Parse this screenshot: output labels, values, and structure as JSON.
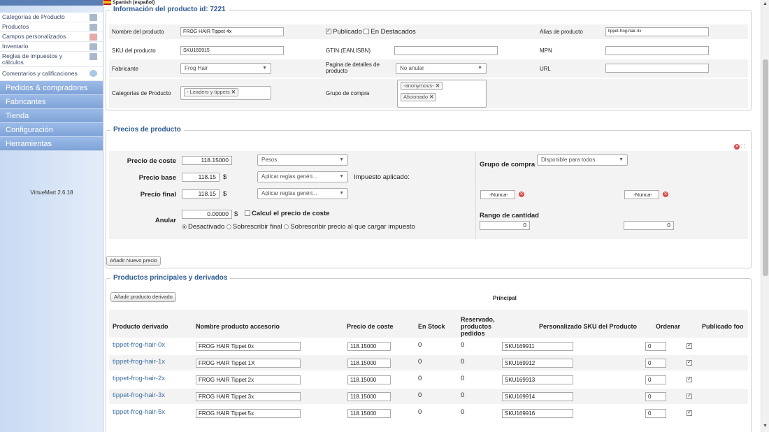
{
  "sidebar": {
    "items": [
      "Categorías de Producto",
      "Productos",
      "Campos personalizados",
      "Inventario",
      "Reglas de impuestos y cálculos",
      "Comentarios y calificaciones"
    ],
    "menu": [
      "Pedidos & compradores",
      "Fabricantes",
      "Tienda",
      "Configuración",
      "Herramientas"
    ],
    "version": "VirtueMart 2.6.18"
  },
  "lang": "Spanish (español)",
  "info": {
    "legend": "Información del producto id: 7221",
    "name_label": "Nombre del producto",
    "name_value": "FROG HAIR Tippet 4x",
    "published": "Publicado",
    "featured": "En Destacados",
    "alias_label": "Alias de producto",
    "alias_value": "tippet-frog-hair-4x",
    "sku_label": "SKU del producto",
    "sku_value": "SKU169915",
    "gtin_label": "GTIN (EAN,ISBN)",
    "mpn_label": "MPN",
    "mfr_label": "Fabricante",
    "mfr_value": "Frog Hair",
    "detail_label": "Pagina de detalles de producto",
    "detail_value": "No anular",
    "url_label": "URL",
    "cat_label": "Categorías de Producto",
    "cat_chip": "- Leaders y tippets",
    "group_label": "Grupo de compra",
    "group_chips": [
      "-anonymous-",
      "Aficionado"
    ]
  },
  "price": {
    "legend": "Precios de producto",
    "cost_label": "Precio de coste",
    "cost_value": "118.15000",
    "currency": "Pesos",
    "group_label": "Grupo de compra",
    "group_value": "Disponible para todos",
    "base_label": "Precio base",
    "base_value": "118.15",
    "dollar": "$",
    "rule": "Aplicar reglas genéri...",
    "tax_label": "Impuesto aplicado:",
    "final_label": "Precio final",
    "final_value": "118.15",
    "never1": "-Nunca-",
    "never2": "-Nunca-",
    "override_label": "Anular",
    "override_value": "0.00000",
    "calc_label": "Calcul el precio de coste",
    "opt1": "Desactivado",
    "opt2": "Sobrescribir final",
    "opt3": "Sobrescribir precio al que cargar impuesto",
    "range_label": "Rango de cantidad",
    "range_from": "0",
    "range_to": "0",
    "add_price": "Añadir Nuevo precio"
  },
  "derived": {
    "legend": "Productos principales y derivados",
    "add_btn": "Añadir producto derivado",
    "principal": "Principal",
    "headers": [
      "Producto derivado",
      "Nombre producto accesorio",
      "Precio de coste",
      "En Stock",
      "Reservado, productos pedidos",
      "Personalizado SKU del Producto",
      "Ordenar",
      "Publicado foo"
    ],
    "rows": [
      {
        "slug": "tippet-frog-hair-0x",
        "name": "FROG HAIR Tippet 0x",
        "price": "118.15000",
        "stock": "0",
        "reserved": "0",
        "sku": "SKU169911",
        "order": "0"
      },
      {
        "slug": "tippet-frog-hair-1x",
        "name": "FROG HAIR Tippet 1X",
        "price": "118.15000",
        "stock": "0",
        "reserved": "0",
        "sku": "SKU169912",
        "order": "0"
      },
      {
        "slug": "tippet-frog-hair-2x",
        "name": "FROG HAIR Tippet 2x",
        "price": "118.15000",
        "stock": "0",
        "reserved": "0",
        "sku": "SKU169913",
        "order": "0"
      },
      {
        "slug": "tippet-frog-hair-3x",
        "name": "FROG HAIR Tippet 3x",
        "price": "118.15000",
        "stock": "0",
        "reserved": "0",
        "sku": "SKU169914",
        "order": "0"
      },
      {
        "slug": "tippet-frog-hair-5x",
        "name": "FROG HAIR Tippet 5x",
        "price": "118.15000",
        "stock": "0",
        "reserved": "0",
        "sku": "SKU169916",
        "order": "0"
      }
    ]
  }
}
